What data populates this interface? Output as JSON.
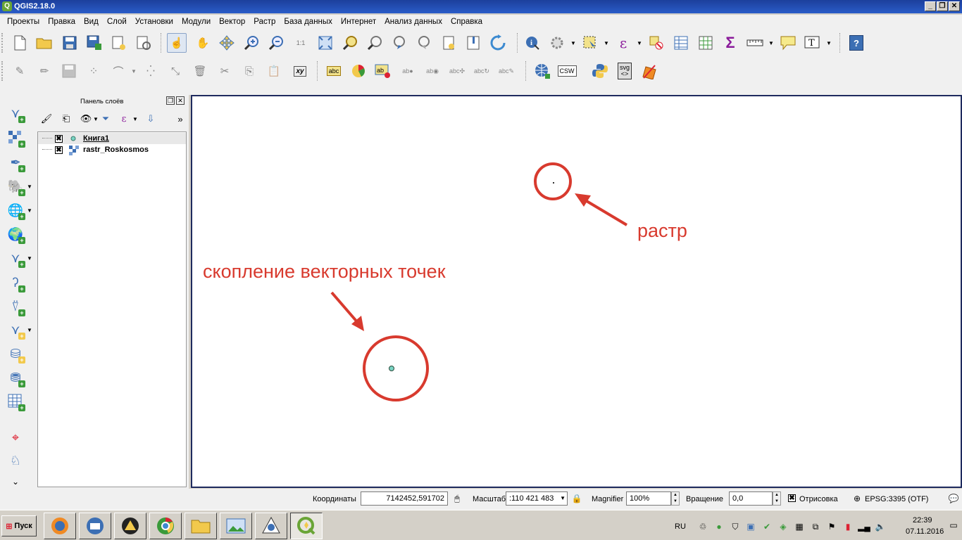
{
  "window": {
    "title": "QGIS2.18.0",
    "minimize": "_",
    "maximize": "❐",
    "close": "✕"
  },
  "menu": [
    "Проекты",
    "Правка",
    "Вид",
    "Слой",
    "Установки",
    "Модули",
    "Вектор",
    "Растр",
    "База данных",
    "Интернет",
    "Анализ данных",
    "Справка"
  ],
  "toolbar_icons": {
    "zoom_ratio": "1:1",
    "xy": "xy",
    "abc": "abc",
    "csw": "CSW",
    "svg": "svg",
    "svg_sub": "<>",
    "help": "?"
  },
  "layers_panel": {
    "title": "Панель слоёв",
    "more": "»",
    "layers": [
      {
        "name": "Книга1",
        "checked": "✖",
        "type": "point"
      },
      {
        "name": "rastr_Roskosmos",
        "checked": "✖",
        "type": "raster"
      }
    ]
  },
  "canvas": {
    "annotation_raster": "растр",
    "annotation_vector": "скопление векторных точек",
    "annotation_color": "#d83a2e"
  },
  "statusbar": {
    "coord_label": "Координаты",
    "coord_value": "7142452,591702",
    "scale_label": "Масштаб",
    "scale_value": ":110 421 483",
    "magnifier_label": "Magnifier",
    "magnifier_value": "100%",
    "rotation_label": "Вращение",
    "rotation_value": "0,0",
    "render_label": "Отрисовка",
    "render_checked": "✖",
    "crs": "EPSG:3395 (OTF)"
  },
  "taskbar": {
    "start_label": "Пуск",
    "lang": "RU",
    "time": "22:39",
    "date": "07.11.2016"
  }
}
